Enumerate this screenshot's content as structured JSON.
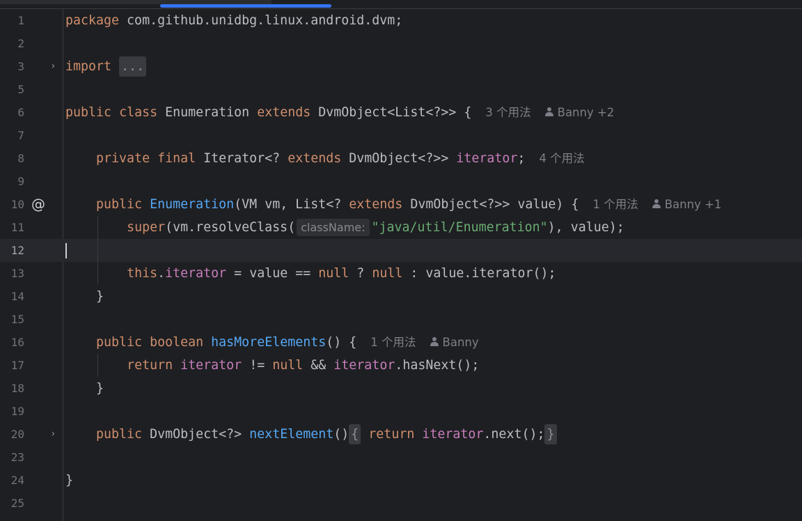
{
  "editor": {
    "lines": [
      {
        "num": "1"
      },
      {
        "num": "2"
      },
      {
        "num": "3"
      },
      {
        "num": "5"
      },
      {
        "num": "6"
      },
      {
        "num": "7"
      },
      {
        "num": "8"
      },
      {
        "num": "9"
      },
      {
        "num": "10"
      },
      {
        "num": "11"
      },
      {
        "num": "12"
      },
      {
        "num": "13"
      },
      {
        "num": "14"
      },
      {
        "num": "15"
      },
      {
        "num": "16"
      },
      {
        "num": "17"
      },
      {
        "num": "18"
      },
      {
        "num": "19"
      },
      {
        "num": "20"
      },
      {
        "num": "23"
      },
      {
        "num": "24"
      },
      {
        "num": "25"
      }
    ],
    "gutter": {
      "annotation_symbol": "@",
      "fold_arrow": "›"
    },
    "tokens": {
      "package": "package",
      "package_name": " com.github.unidbg.linux.android.dvm;",
      "import": "import",
      "import_fold": "...",
      "public": "public",
      "class": "class",
      "class_name": " Enumeration ",
      "extends": "extends",
      "class_super": " DvmObject<List<?>> {",
      "private": "private",
      "final": "final",
      "iterator_type": " Iterator<? ",
      "dvm_object_generic": " DvmObject<?>> ",
      "iterator": "iterator",
      "semicolon": ";",
      "constructor_name": "Enumeration",
      "ctor_params_1": "(VM vm, List<? ",
      "ctor_params_2": " DvmObject<?>> value) {",
      "super": "super",
      "super_call": "(vm.resolveClass(",
      "param_hint": "className:",
      "string_literal": "\"java/util/Enumeration\"",
      "super_end": "), value);",
      "this": "this",
      "dot": ".",
      "assign": " = value == ",
      "null": "null",
      "ternary": " ? ",
      "colon": " : ",
      "value_iterator": "value.iterator();",
      "close_brace": "}",
      "boolean": "boolean",
      "has_more_elements": "hasMoreElements",
      "open_method": "() {",
      "return": "return",
      "neq": " != ",
      "and": " && ",
      "has_next": ".hasNext();",
      "next_type": " DvmObject<?> ",
      "next_element": "nextElement",
      "paren": "()",
      "fold_open": "{",
      "fold_close": "}",
      "next_call": ".next();"
    },
    "lenses": {
      "class_usages": "3 个用法",
      "class_author": "Banny +2",
      "field_usages": "4 个用法",
      "ctor_usages": "1 个用法",
      "ctor_author": "Banny +1",
      "method_usages": "1 个用法",
      "method_author": "Banny"
    }
  },
  "colors": {
    "background": "#1e1f22",
    "keyword": "#cf8e6d",
    "method": "#56a8f5",
    "field": "#c77dbb",
    "string": "#6aab73",
    "text": "#bcbec4",
    "accent": "#3574f0"
  }
}
